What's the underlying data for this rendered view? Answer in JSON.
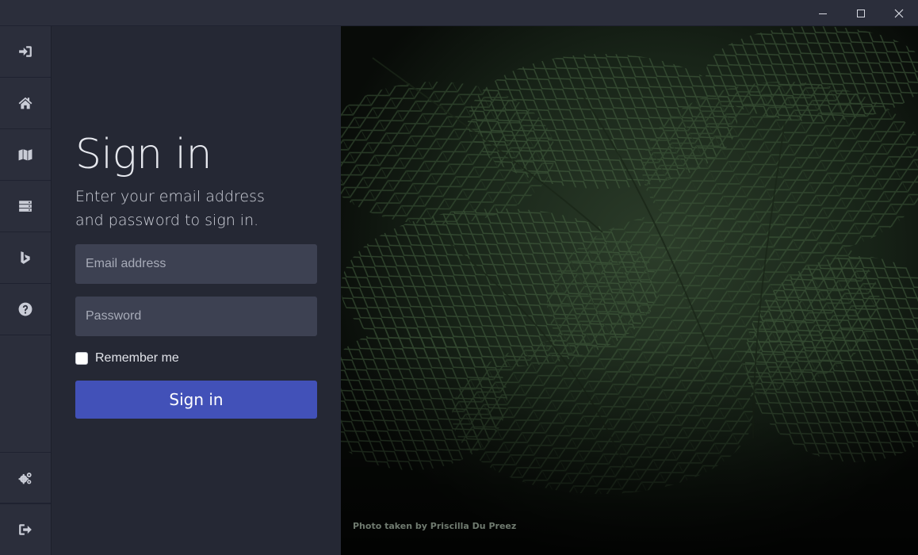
{
  "window": {
    "controls": [
      "minimize",
      "maximize",
      "close"
    ]
  },
  "sidebar": {
    "items": [
      {
        "icon": "sign-in-icon"
      },
      {
        "icon": "home-icon"
      },
      {
        "icon": "map-icon"
      },
      {
        "icon": "server-icon"
      },
      {
        "icon": "bing-icon"
      },
      {
        "icon": "help-icon"
      }
    ],
    "bottom_items": [
      {
        "icon": "gears-icon"
      },
      {
        "icon": "sign-out-icon"
      }
    ]
  },
  "form": {
    "title": "Sign in",
    "subtitle": "Enter your email address and password to sign in.",
    "email_placeholder": "Email address",
    "password_placeholder": "Password",
    "remember_label": "Remember me",
    "submit_label": "Sign in"
  },
  "photo": {
    "credit": "Photo taken by Priscilla Du Preez"
  },
  "colors": {
    "accent": "#4251b8",
    "panel": "#252834",
    "sidebar": "#2b2e3b",
    "field": "#3d4152"
  }
}
